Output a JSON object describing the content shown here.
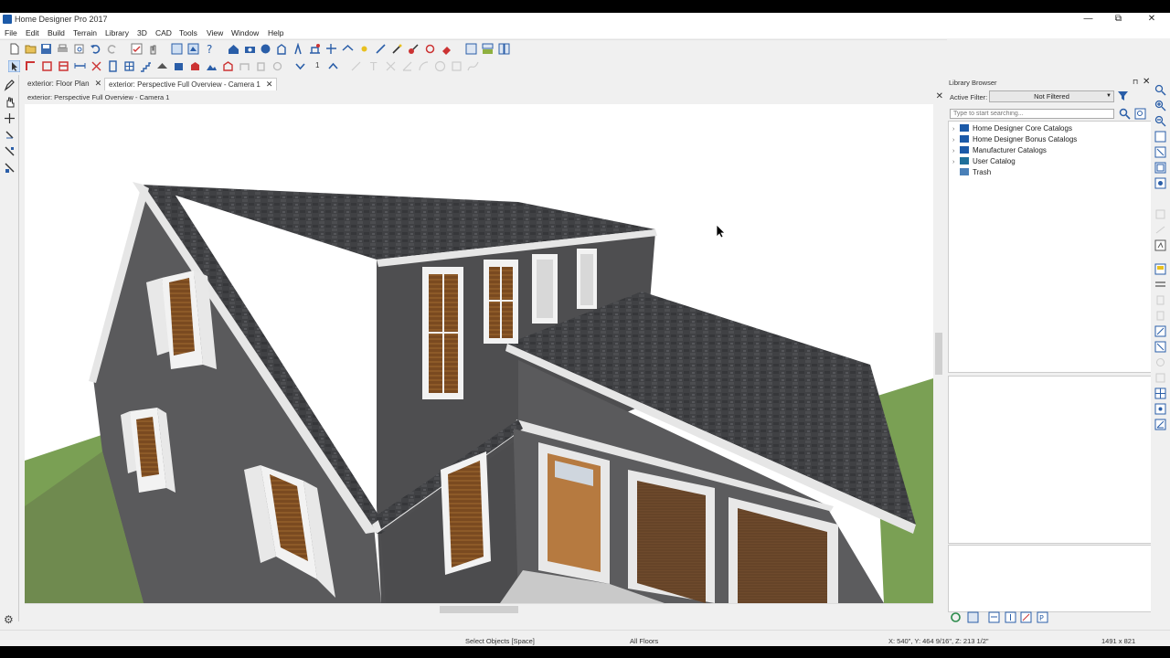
{
  "window": {
    "title": "Home Designer Pro 2017",
    "minimize": "—",
    "restore": "⧉",
    "close": "✕"
  },
  "menu": [
    "File",
    "Edit",
    "Build",
    "Terrain",
    "Library",
    "3D",
    "CAD",
    "Tools",
    "View",
    "Window",
    "Help"
  ],
  "tabs": [
    {
      "label": "exterior: Floor Plan",
      "close": "✕"
    },
    {
      "label": "exterior: Perspective Full Overview - Camera 1",
      "close": "✕"
    }
  ],
  "toolbar2": {
    "counter": "1"
  },
  "document": {
    "header": "exterior: Perspective Full Overview - Camera 1",
    "close": "✕"
  },
  "library": {
    "title": "Library Browser",
    "pin": "⊓",
    "close": "✕",
    "filter_label": "Active Filter:",
    "filter_value": "Not Filtered",
    "search_placeholder": "Type to start searching...",
    "tree": [
      {
        "label": "Home Designer Core Catalogs",
        "expand": "›"
      },
      {
        "label": "Home Designer Bonus Catalogs",
        "expand": "›"
      },
      {
        "label": "Manufacturer Catalogs",
        "expand": "›"
      },
      {
        "label": "User Catalog",
        "expand": "›"
      },
      {
        "label": "Trash",
        "expand": ""
      }
    ]
  },
  "status": {
    "mode": "Select Objects [Space]",
    "floors": "All Floors",
    "coords": "X: 540\", Y: 464 9/16\", Z: 213 1/2\"",
    "size": "1491 x 821"
  },
  "colors": {
    "accent": "#1c5aa8",
    "siding": "#5a5a5c",
    "roof": "#3e3f42",
    "trim": "#e8e8e8",
    "grass": "#7aa054"
  }
}
